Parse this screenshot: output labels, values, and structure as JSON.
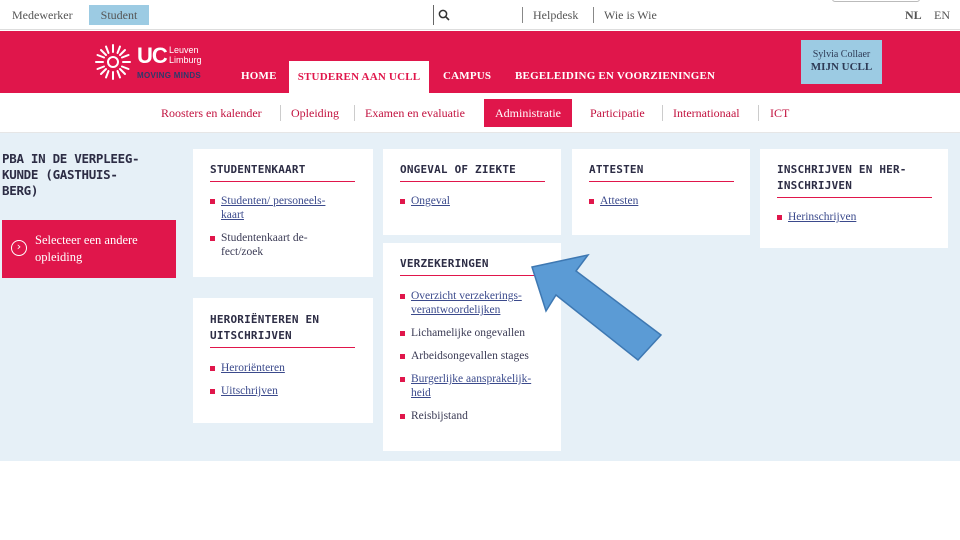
{
  "topbar": {
    "medewerker": "Medewerker",
    "student": "Student",
    "helpdesk": "Helpdesk",
    "wie_is_wie": "Wie is Wie",
    "lang_nl": "NL",
    "lang_en": "EN"
  },
  "header": {
    "logo_uc": "UC",
    "logo_place_1": "Leuven",
    "logo_place_2": "Limburg",
    "logo_tagline": "MOVING MINDS",
    "nav": [
      "HOME",
      "STUDEREN AAN UCLL",
      "CAMPUS",
      "BEGELEIDING EN VOORZIENINGEN"
    ],
    "user_name": "Sylvia Collaer",
    "mijn_ucll": "MIJN UCLL"
  },
  "subnav": [
    "Roosters en kalender",
    "Opleiding",
    "Examen en evaluatie",
    "Administratie",
    "Participatie",
    "Internationaal",
    "ICT"
  ],
  "sidebar": {
    "title": "PBA IN DE VERPLEEG-KUNDE (GASTHUIS-BERG)",
    "title_lines": [
      "PBA IN DE VERPLEEG-",
      "KUNDE (GASTHUIS-",
      "BERG)"
    ],
    "button_lines": [
      "Selecteer een andere",
      "opleiding"
    ]
  },
  "cards": {
    "studentenkaart": {
      "title": "STUDENTENKAART",
      "items": [
        "Studenten/ personeels-kaart",
        "Studentenkaart de-fect/zoek"
      ]
    },
    "ongeval": {
      "title": "ONGEVAL OF ZIEKTE",
      "items": [
        "Ongeval"
      ]
    },
    "attesten": {
      "title": "ATTESTEN",
      "items": [
        "Attesten"
      ]
    },
    "inschrijven": {
      "title": "INSCHRIJVEN EN HER-INSCHRIJVEN",
      "title_lines": [
        "INSCHRIJVEN EN HER-",
        "INSCHRIJVEN"
      ],
      "items": [
        "Herinschrijven"
      ]
    },
    "verzekeringen": {
      "title": "VERZEKERINGEN",
      "items": [
        "Overzicht verzekerings-verantwoordelijken",
        "Lichamelijke ongevallen",
        "Arbeidsongevallen stages",
        "Burgerlijke aansprakelijk-heid",
        "Reisbijstand"
      ]
    },
    "heroriënteren": {
      "title": "HERORIËNTEREN EN UITSCHRIJVEN",
      "title_lines": [
        "HERORIËNTEREN EN",
        "UITSCHRIJVEN"
      ],
      "items": [
        "Heroriënteren",
        "Uitschrijven"
      ]
    }
  },
  "colors": {
    "brand_red": "#e0164b",
    "light_blue": "#9ccbe3",
    "content_bg": "#e6f0f7",
    "arrow_fill": "#5b9bd5"
  },
  "icons": [
    "search-icon",
    "arrow-circle-icon",
    "logo-sun-icon",
    "annotation-arrow"
  ]
}
